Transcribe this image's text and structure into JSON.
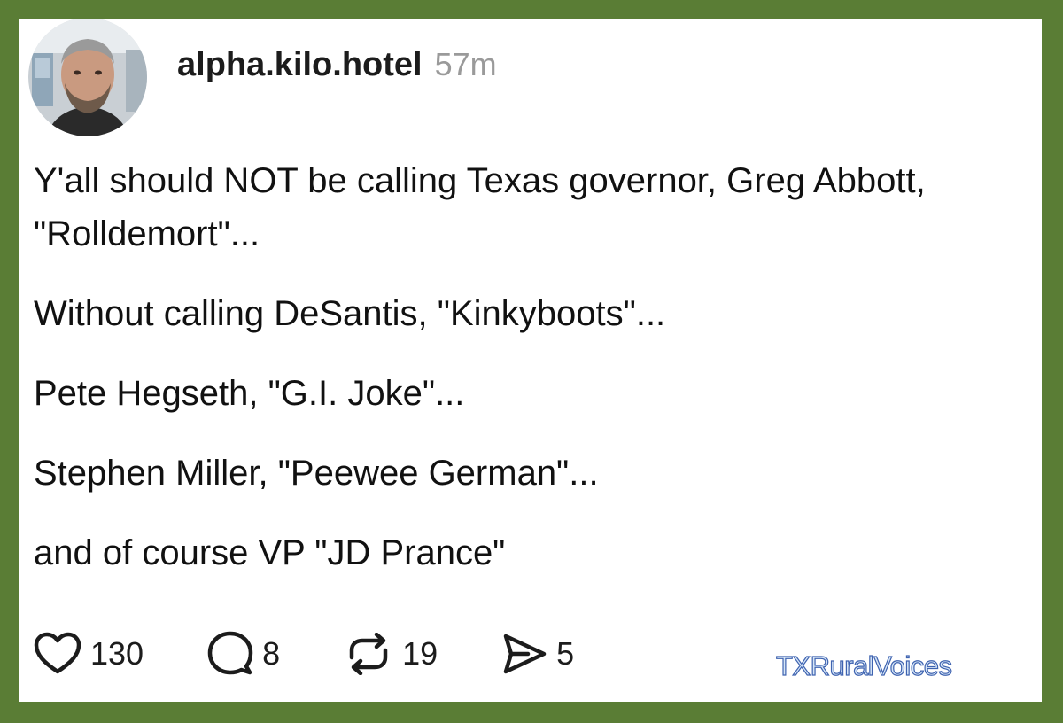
{
  "post": {
    "author": {
      "username": "alpha.kilo.hotel",
      "timestamp": "57m"
    },
    "paragraphs": [
      "Y'all should NOT be calling Texas governor, Greg Abbott, \"Rolldemort\"...",
      "Without calling DeSantis, \"Kinkyboots\"...",
      "Pete Hegseth, \"G.I. Joke\"...",
      "Stephen Miller, \"Peewee German\"...",
      "and of course VP \"JD Prance\""
    ],
    "actions": {
      "likes": "130",
      "replies": "8",
      "reposts": "19",
      "shares": "5"
    }
  },
  "watermark": "TXRuralVoices",
  "icons": [
    "heart-icon",
    "comment-icon",
    "repost-icon",
    "share-icon"
  ],
  "colors": {
    "frame": "#5a7d35",
    "card": "#ffffff",
    "text": "#111111",
    "muted": "#9a9a9a",
    "watermark_stroke": "#3f63b0"
  }
}
